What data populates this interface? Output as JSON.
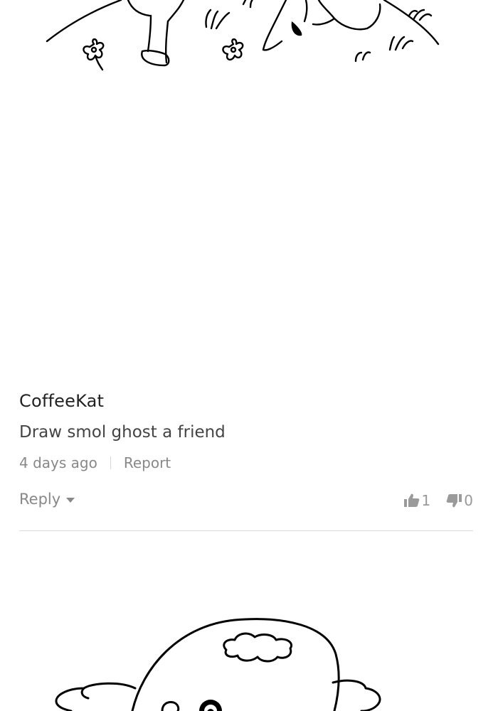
{
  "comment": {
    "username": "CoffeeKat",
    "text": "Draw smol ghost a friend",
    "timestamp": "4 days ago",
    "report_label": "Report",
    "reply_label": "Reply",
    "upvotes": "1",
    "downvotes": "0"
  },
  "icons": {
    "reply_caret": "caret-down-icon",
    "upvote": "thumbs-up-icon",
    "downvote": "thumbs-down-icon"
  },
  "colors": {
    "username": "#222222",
    "text": "#444444",
    "meta": "#888888",
    "divider": "#dcdcdc"
  }
}
